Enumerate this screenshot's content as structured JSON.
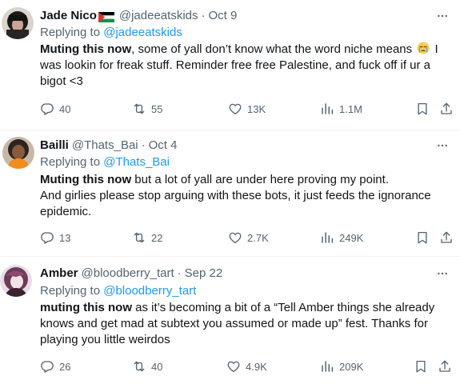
{
  "tweets": [
    {
      "name": "Jade Nico",
      "handle": "@jadeeatskids",
      "time": "Oct 9",
      "replying_label": "Replying to ",
      "replying_handle": "@jadeeatskids",
      "text_bold": "Muting this now",
      "text_1": ", some of yall don’t know what the word niche means ",
      "text_2": " I was lookin for freak stuff. Reminder free free Palestine, and fuck off if ur a bigot <3",
      "replies": "40",
      "reposts": "55",
      "likes": "13K",
      "views": "1.1M"
    },
    {
      "name": "Bailli",
      "handle": "@Thats_Bai",
      "time": "Oct 4",
      "replying_label": "Replying to ",
      "replying_handle": "@Thats_Bai",
      "text_bold": "Muting this now",
      "text_1": " but a lot of yall are under here proving my point.",
      "text_2": "And girlies please stop arguing with these bots, it just feeds the ignorance epidemic.",
      "replies": "13",
      "reposts": "22",
      "likes": "2.7K",
      "views": "249K"
    },
    {
      "name": "Amber",
      "handle": "@bloodberry_tart",
      "time": "Sep 22",
      "replying_label": "Replying to ",
      "replying_handle": "@bloodberry_tart",
      "text_bold": "muting this now",
      "text_1": " as it’s becoming a bit of a “Tell Amber things she already knows and get mad at subtext you assumed or made up” fest. Thanks for playing you little weirdos",
      "replies": "26",
      "reposts": "40",
      "likes": "4.9K",
      "views": "209K"
    }
  ],
  "separator": "·",
  "colors": {
    "text": "#0f1419",
    "secondary": "#536471",
    "link": "#1d9bf0",
    "divider": "#eff3f4"
  },
  "icons": [
    "reply-icon",
    "repost-icon",
    "like-icon",
    "views-icon",
    "bookmark-icon",
    "share-icon",
    "more-icon",
    "palestine-flag-icon",
    "crying-face-emoji"
  ]
}
